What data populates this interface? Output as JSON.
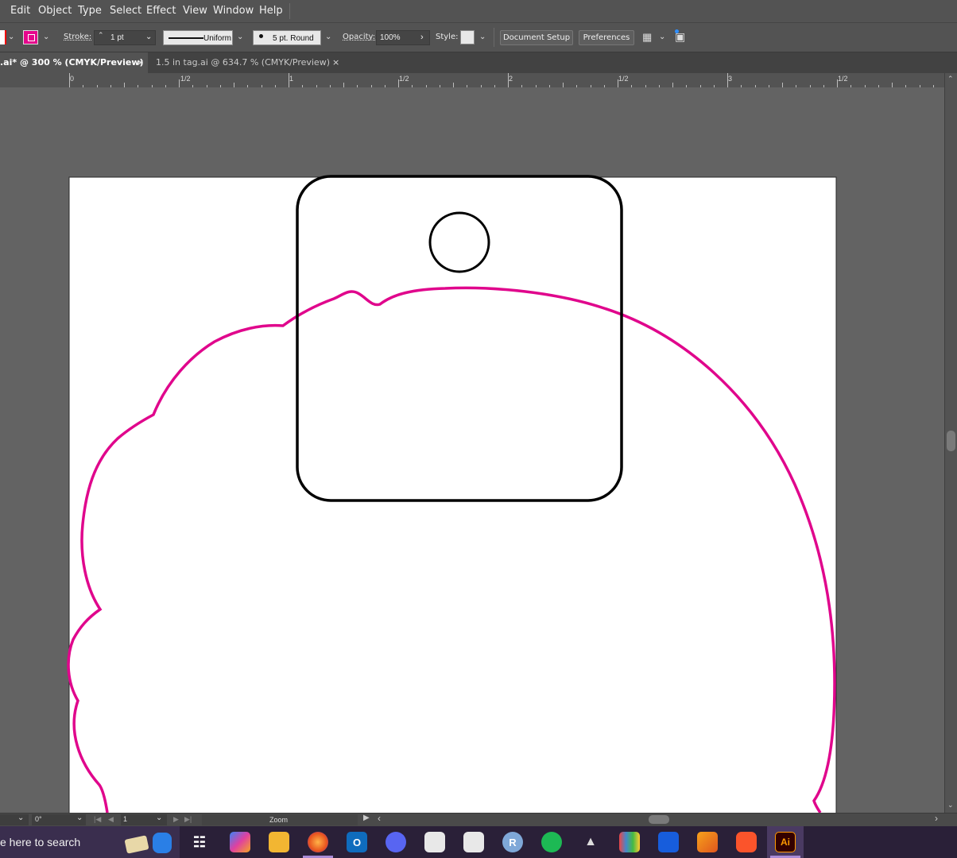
{
  "menu": {
    "items": [
      "Edit",
      "Object",
      "Type",
      "Select",
      "Effect",
      "View",
      "Window",
      "Help"
    ]
  },
  "control_bar": {
    "stroke_label": "Stroke:",
    "stroke_weight": "1 pt",
    "stroke_profile": "Uniform",
    "brush": "5 pt. Round",
    "opacity_label": "Opacity:",
    "opacity_value": "100%",
    "style_label": "Style:",
    "document_setup": "Document Setup",
    "preferences": "Preferences",
    "stroke_color": "#e6058c"
  },
  "tabs": [
    {
      "label": ".ai* @ 300 % (CMYK/Preview)",
      "close": "×"
    },
    {
      "label": "1.5 in tag.ai @ 634.7 % (CMYK/Preview)",
      "close": "×"
    }
  ],
  "ruler": {
    "labels": [
      "0",
      "1/2",
      "1",
      "1/2",
      "2",
      "1/2",
      "3",
      "1/2"
    ]
  },
  "status_bar": {
    "rotation": "0°",
    "artboard": "1",
    "mode": "Zoom"
  },
  "taskbar": {
    "search_placeholder": "e here to search",
    "illustrator_label": "Ai",
    "r_label": "R"
  },
  "colors": {
    "cut_line": "#e0068c",
    "tag_outline": "#000000"
  }
}
